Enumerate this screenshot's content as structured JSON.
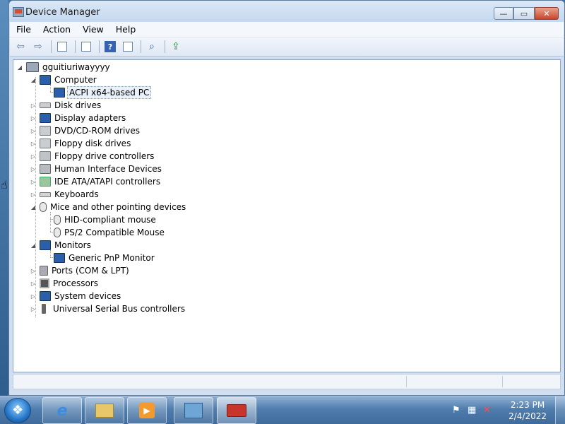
{
  "window": {
    "title": "Device Manager",
    "buttons": {
      "minimize": "—",
      "maximize": "▭",
      "close": "✕"
    }
  },
  "menu": [
    "File",
    "Action",
    "View",
    "Help"
  ],
  "toolbar": {
    "buttons": [
      "back-icon",
      "forward-icon",
      "show-hide-console-tree-icon",
      "properties-icon",
      "help-icon",
      "show-action-pane-icon",
      "scan-hardware-icon",
      "update-driver-icon"
    ]
  },
  "tree": {
    "root": "gguitiuriwayyyy",
    "items": [
      {
        "label": "Computer",
        "icon": "computer-icon",
        "expanded": true,
        "children": [
          "ACPI x64-based PC"
        ]
      },
      {
        "label": "Disk drives",
        "icon": "disk-drive-icon"
      },
      {
        "label": "Display adapters",
        "icon": "display-adapter-icon"
      },
      {
        "label": "DVD/CD-ROM drives",
        "icon": "dvd-drive-icon"
      },
      {
        "label": "Floppy disk drives",
        "icon": "floppy-drive-icon"
      },
      {
        "label": "Floppy drive controllers",
        "icon": "floppy-controller-icon"
      },
      {
        "label": "Human Interface Devices",
        "icon": "hid-icon"
      },
      {
        "label": "IDE ATA/ATAPI controllers",
        "icon": "ide-controller-icon"
      },
      {
        "label": "Keyboards",
        "icon": "keyboard-icon"
      },
      {
        "label": "Mice and other pointing devices",
        "icon": "mouse-icon",
        "expanded": true,
        "children": [
          "HID-compliant mouse",
          "PS/2 Compatible Mouse"
        ]
      },
      {
        "label": "Monitors",
        "icon": "monitor-icon",
        "expanded": true,
        "children": [
          "Generic PnP Monitor"
        ]
      },
      {
        "label": "Ports (COM & LPT)",
        "icon": "port-icon"
      },
      {
        "label": "Processors",
        "icon": "processor-icon"
      },
      {
        "label": "System devices",
        "icon": "system-device-icon"
      },
      {
        "label": "Universal Serial Bus controllers",
        "icon": "usb-icon"
      }
    ],
    "selected": "ACPI x64-based PC"
  },
  "taskbar": {
    "apps": [
      "internet-explorer-icon",
      "windows-explorer-icon",
      "media-player-icon",
      "control-panel-icon",
      "toolbox-icon"
    ],
    "active_app": "toolbox-icon",
    "tray_icons": [
      "action-center-flag-icon",
      "network-icon",
      "volume-muted-icon"
    ]
  },
  "clock": {
    "time": "2:23 PM",
    "date": "2/4/2022"
  }
}
